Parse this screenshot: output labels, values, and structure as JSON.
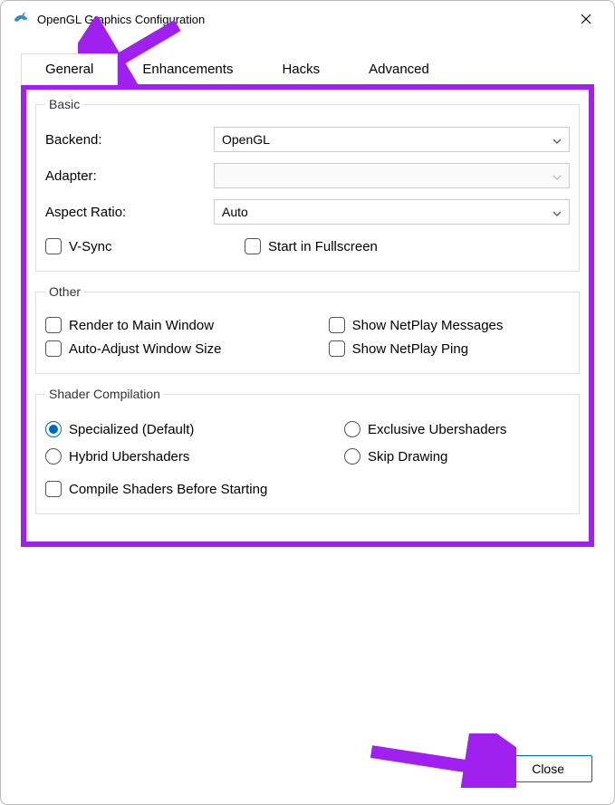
{
  "window": {
    "title": "OpenGL Graphics Configuration"
  },
  "tabs": {
    "general": "General",
    "enhancements": "Enhancements",
    "hacks": "Hacks",
    "advanced": "Advanced"
  },
  "basic": {
    "legend": "Basic",
    "backend_label": "Backend:",
    "backend_value": "OpenGL",
    "adapter_label": "Adapter:",
    "adapter_value": "",
    "aspect_label": "Aspect Ratio:",
    "aspect_value": "Auto",
    "vsync": "V-Sync",
    "fullscreen": "Start in Fullscreen"
  },
  "other": {
    "legend": "Other",
    "render_main": "Render to Main Window",
    "show_netplay_msg": "Show NetPlay Messages",
    "auto_adjust": "Auto-Adjust Window Size",
    "show_netplay_ping": "Show NetPlay Ping"
  },
  "shader": {
    "legend": "Shader Compilation",
    "specialized": "Specialized (Default)",
    "exclusive": "Exclusive Ubershaders",
    "hybrid": "Hybrid Ubershaders",
    "skip": "Skip Drawing",
    "compile_before": "Compile Shaders Before Starting"
  },
  "footer": {
    "close": "Close"
  }
}
